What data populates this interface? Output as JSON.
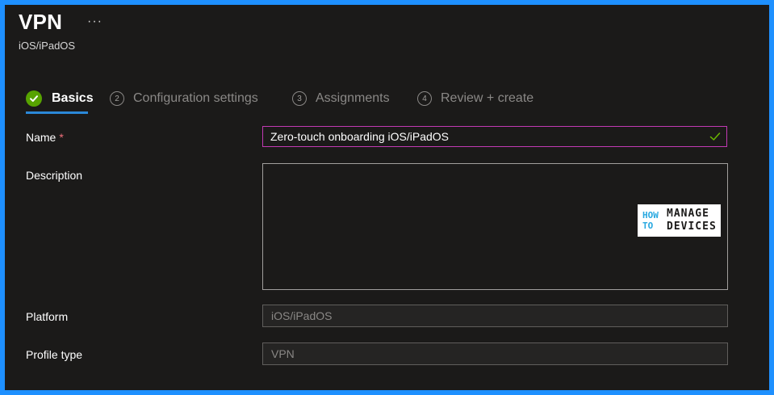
{
  "header": {
    "title": "VPN",
    "more_label": "···",
    "subtitle": "iOS/iPadOS"
  },
  "steps": [
    {
      "number": "",
      "label": "Basics",
      "state": "completed"
    },
    {
      "number": "2",
      "label": "Configuration settings",
      "state": "pending"
    },
    {
      "number": "3",
      "label": "Assignments",
      "state": "pending"
    },
    {
      "number": "4",
      "label": "Review + create",
      "state": "pending"
    }
  ],
  "form": {
    "name": {
      "label": "Name",
      "required_marker": "*",
      "value": "Zero-touch onboarding iOS/iPadOS",
      "valid_icon": "checkmark-icon"
    },
    "description": {
      "label": "Description",
      "value": ""
    },
    "platform": {
      "label": "Platform",
      "value": "iOS/iPadOS"
    },
    "profile_type": {
      "label": "Profile type",
      "value": "VPN"
    }
  },
  "watermark": {
    "how": "HOW",
    "to": "TO",
    "manage": "MANAGE",
    "devices": "DEVICES"
  },
  "colors": {
    "border_blue": "#1e90ff",
    "background": "#1b1a19",
    "accent_underline": "#2b88d8",
    "success_green": "#57a300",
    "focus_border": "#c239b3",
    "required_red": "#f1707b"
  }
}
